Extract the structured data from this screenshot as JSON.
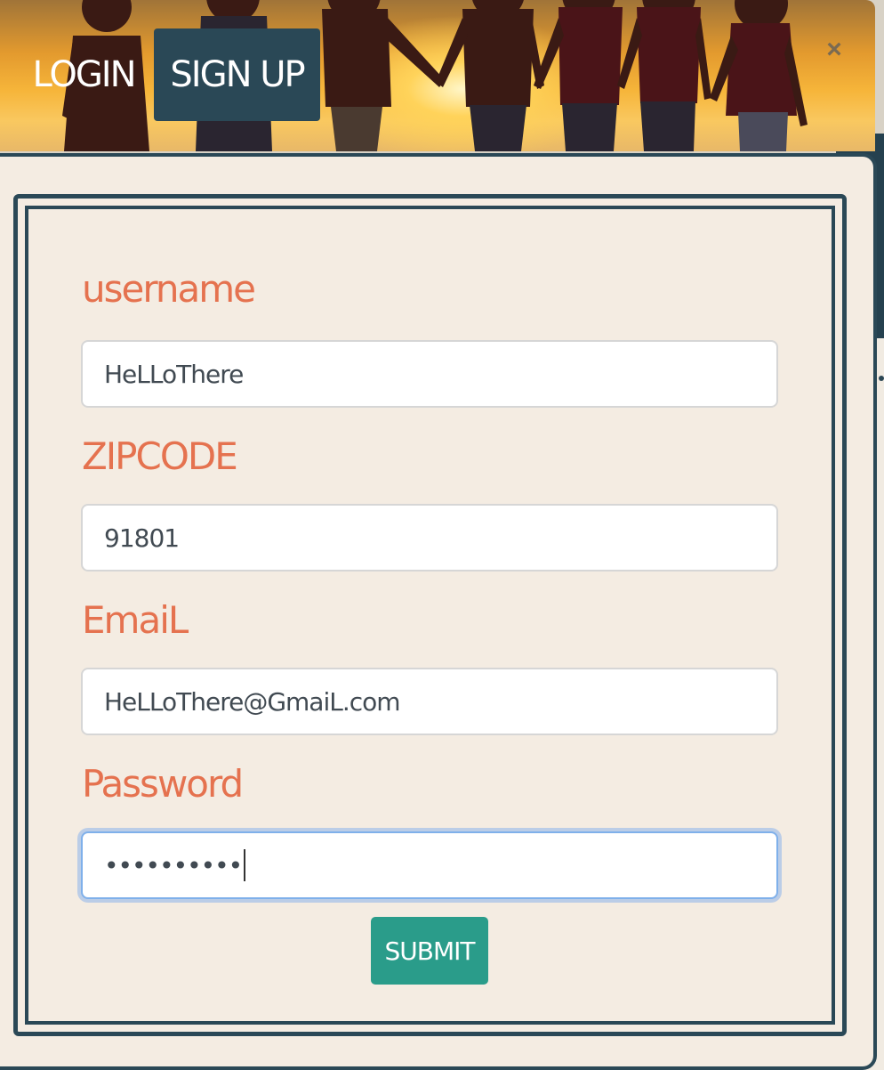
{
  "header": {
    "tabs": [
      {
        "label": "LOGIN",
        "active": false
      },
      {
        "label": "SIGN UP",
        "active": true
      }
    ],
    "close_icon": "close-icon",
    "close_glyph": "×"
  },
  "form": {
    "username": {
      "label": "username",
      "value": "HeLLoThere"
    },
    "zipcode": {
      "label": "ZIPCODE",
      "value": "91801"
    },
    "email": {
      "label": "EmaiL",
      "value": "HeLLoThere@GmaiL.com"
    },
    "password": {
      "label": "Password",
      "value": "••••••••••"
    },
    "submit_label": "SUBMIT"
  },
  "colors": {
    "accent_label": "#e5724f",
    "dark_teal": "#2a4856",
    "submit_green": "#2a9c8a",
    "panel_bg": "#f4ece2"
  }
}
